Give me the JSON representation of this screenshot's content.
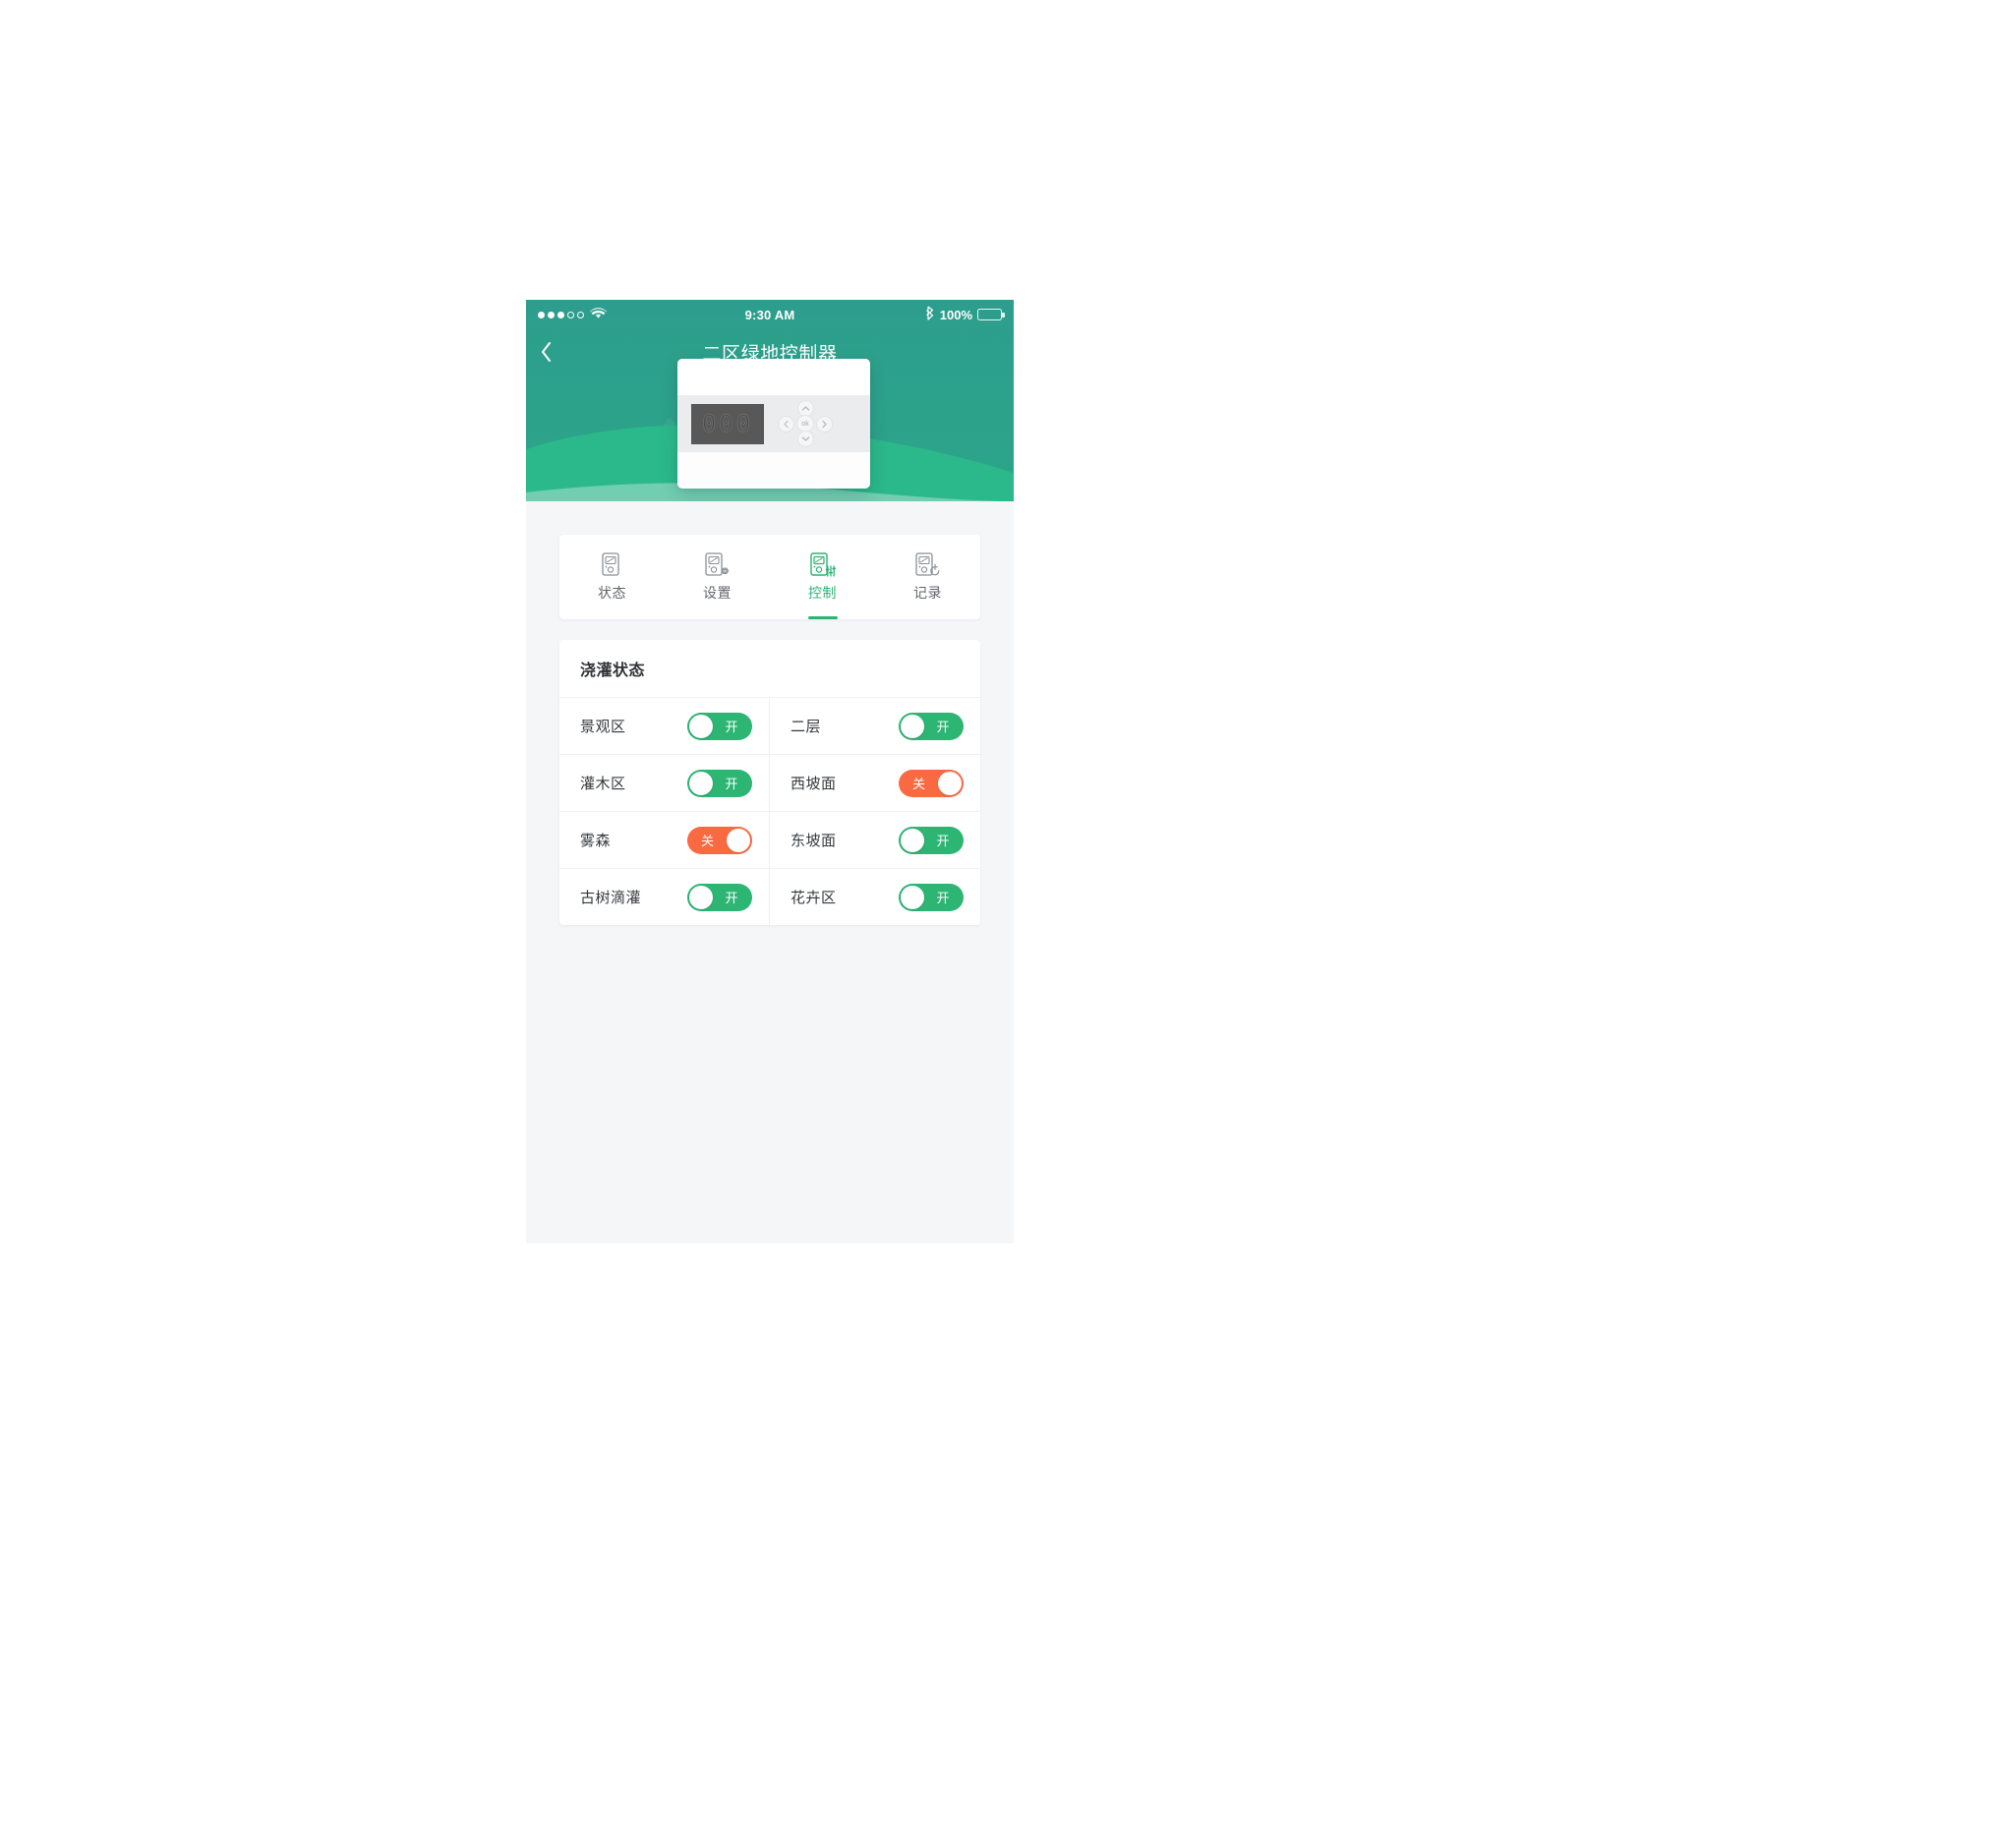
{
  "accent": {
    "green": "#2cb573",
    "orange": "#fa6a42",
    "header_top": "#2d9e8d",
    "header_bottom": "#2ba589",
    "hill": "#2bb98a",
    "page_bg": "#f4f6f8"
  },
  "statusbar": {
    "signal_dots_filled": 3,
    "signal_dots_total": 5,
    "wifi_icon": "wifi-icon",
    "time": "9:30 AM",
    "bluetooth_icon": "bluetooth-icon",
    "battery_percent": "100%",
    "battery_icon": "battery-full-icon"
  },
  "navbar": {
    "back_icon": "chevron-left-icon",
    "title": "二区绿地控制器"
  },
  "device": {
    "display_value": "000",
    "dpad": {
      "up_icon": "chevron-up-icon",
      "down_icon": "chevron-down-icon",
      "left_icon": "chevron-left-icon",
      "right_icon": "chevron-right-icon",
      "ok_label": "ok"
    }
  },
  "tabs": [
    {
      "label": "状态",
      "icon": "device-status-icon",
      "active": false
    },
    {
      "label": "设置",
      "icon": "device-settings-icon",
      "active": false
    },
    {
      "label": "控制",
      "icon": "device-control-icon",
      "active": true
    },
    {
      "label": "记录",
      "icon": "device-history-icon",
      "active": false
    }
  ],
  "irrigation_card": {
    "title": "浇灌状态",
    "on_label": "开",
    "off_label": "关",
    "zones": [
      {
        "label": "景观区",
        "state": "on"
      },
      {
        "label": "二层",
        "state": "on"
      },
      {
        "label": "灌木区",
        "state": "on"
      },
      {
        "label": "西坡面",
        "state": "off"
      },
      {
        "label": "雾森",
        "state": "off"
      },
      {
        "label": "东坡面",
        "state": "on"
      },
      {
        "label": "古树滴灌",
        "state": "on"
      },
      {
        "label": "花卉区",
        "state": "on"
      }
    ]
  }
}
